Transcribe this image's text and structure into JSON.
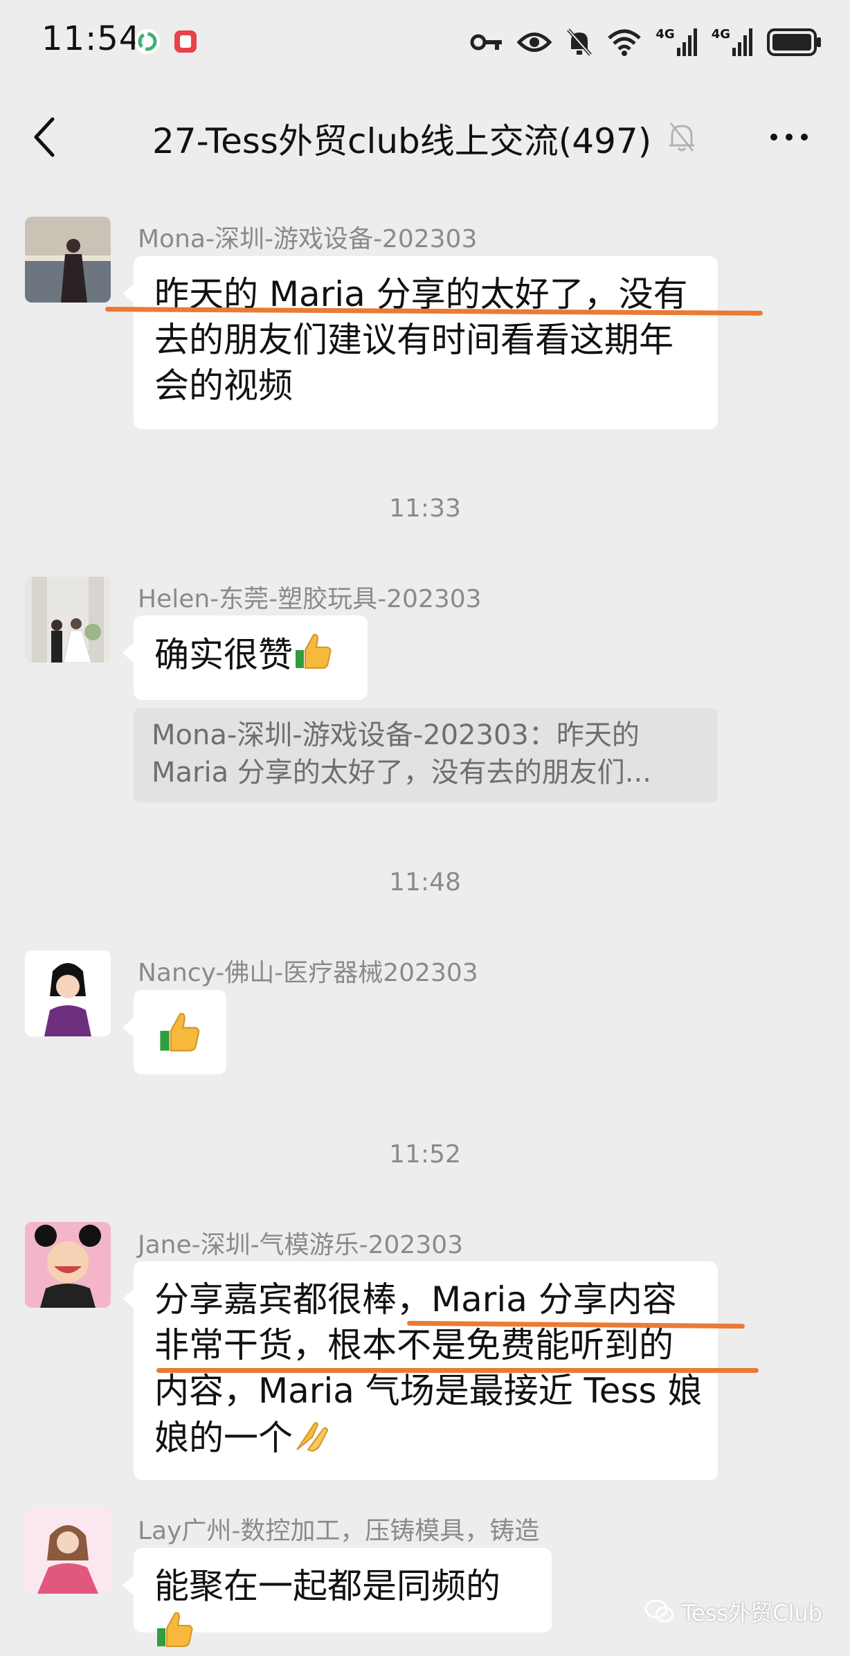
{
  "status_bar": {
    "time": "11:54",
    "network_1": "4G",
    "network_2": "4G"
  },
  "header": {
    "title": "27-Tess外贸club线上交流(497)"
  },
  "messages": [
    {
      "sender": "Mona-深圳-游戏设备-202303",
      "lines": [
        "昨天的 Maria 分享的太好了，没有",
        "去的朋友们建议有时间看看这期年",
        "会的视频"
      ]
    },
    {
      "timestamp": "11:33"
    },
    {
      "sender": "Helen-东莞-塑胶玩具-202303",
      "lines": [
        "确实很赞"
      ],
      "quote_lines": [
        "Mona-深圳-游戏设备-202303：昨天的",
        "Maria 分享的太好了，没有去的朋友们..."
      ]
    },
    {
      "timestamp": "11:48"
    },
    {
      "sender": "Nancy-佛山-医疗器械202303",
      "lines": []
    },
    {
      "timestamp": "11:52"
    },
    {
      "sender": "Jane-深圳-气模游乐-202303",
      "lines": [
        "分享嘉宾都很棒，Maria 分享内容",
        "非常干货，根本不是免费能听到的",
        "内容，Maria 气场是最接近 Tess 娘",
        "娘的一个"
      ]
    },
    {
      "sender": "Lay广州-数控加工，压铸模具，铸造",
      "lines": [
        "能聚在一起都是同频的"
      ]
    }
  ],
  "watermark": "Tess外贸Club",
  "colors": {
    "background": "#ededed",
    "bubble": "#ffffff",
    "quote": "#e2e2e2",
    "highlight_underline": "#e8742a"
  }
}
